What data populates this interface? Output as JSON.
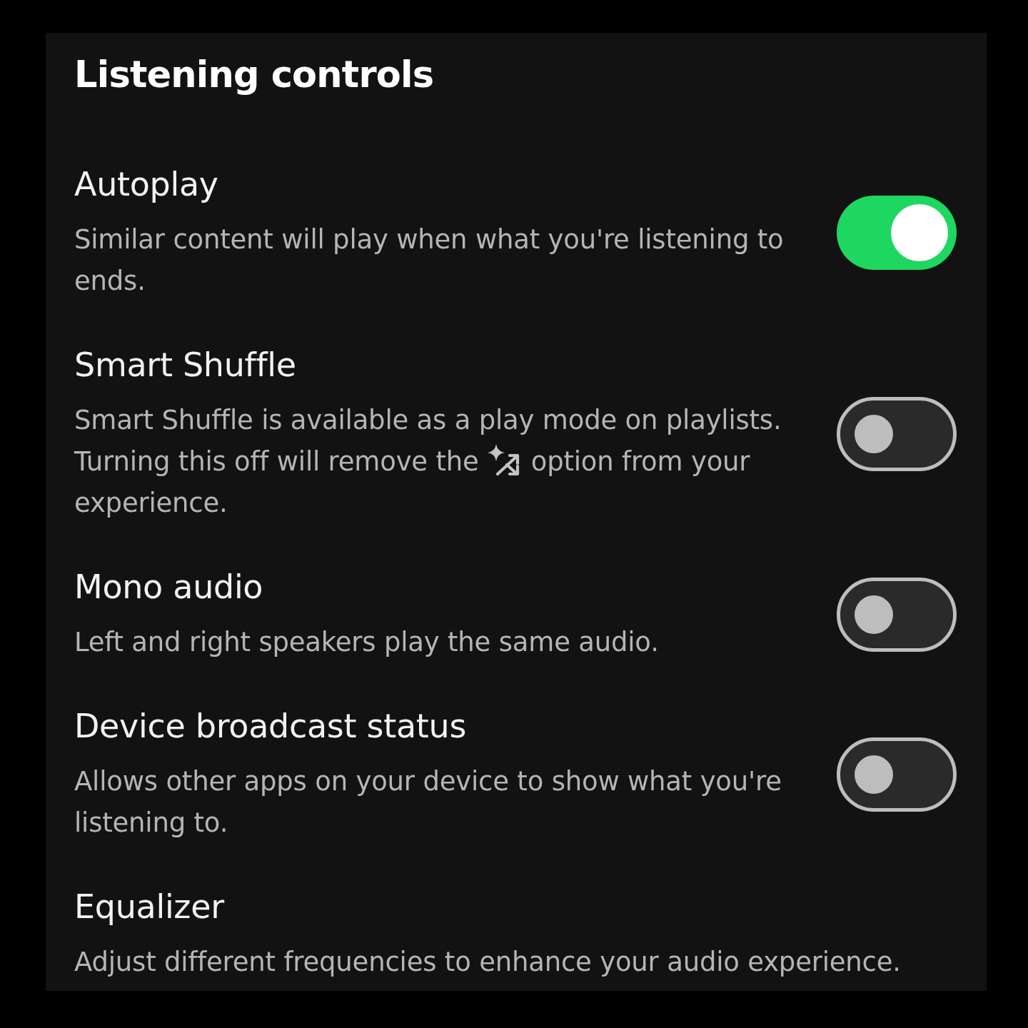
{
  "title": "Listening controls",
  "settings": [
    {
      "label": "Autoplay",
      "description": "Similar content will play when what you're listening to ends.",
      "kind": "toggle",
      "on": true
    },
    {
      "label": "Smart Shuffle",
      "description": "Smart Shuffle is available as a play mode on playlists. Turning this off will remove the",
      "description_after_icon": "option from your experience.",
      "kind": "toggle",
      "on": false
    },
    {
      "label": "Mono audio",
      "description": "Left and right speakers play the same audio.",
      "kind": "toggle",
      "on": false
    },
    {
      "label": "Device broadcast status",
      "description": "Allows other apps on your device to show what you're listening to.",
      "kind": "toggle",
      "on": false
    },
    {
      "label": "Equalizer",
      "description": "Adjust different frequencies to enhance your audio experience.",
      "kind": "navigation"
    }
  ]
}
